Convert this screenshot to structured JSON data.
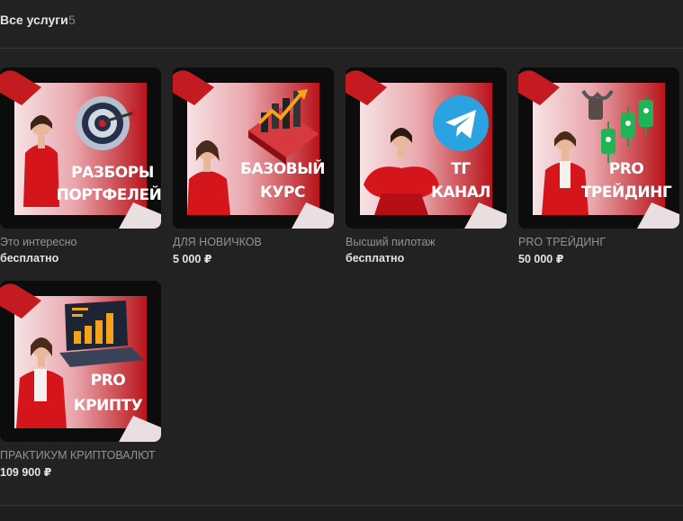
{
  "section": {
    "title": "Все услуги",
    "count": "5"
  },
  "cards": [
    {
      "name": "Это интересно",
      "price": "бесплатно",
      "caption": [
        "РАЗБОРЫ",
        "ПОРТФЕЛЕЙ"
      ],
      "icon": "target-icon"
    },
    {
      "name": "ДЛЯ НОВИЧКОВ",
      "price": "5 000 ₽",
      "caption": [
        "БАЗОВЫЙ",
        "КУРС"
      ],
      "icon": "growth-chart-icon"
    },
    {
      "name": "Высший пилотаж",
      "price": "бесплатно",
      "caption": [
        "ТГ",
        "КАНАЛ"
      ],
      "icon": "telegram-icon"
    },
    {
      "name": "PRO ТРЕЙДИНГ",
      "price": "50 000 ₽",
      "caption": [
        "PRO",
        "ТРЕЙДИНГ"
      ],
      "icon": "candles-icon"
    },
    {
      "name": "ПРАКТИКУМ КРИПТОВАЛЮТ",
      "price": "109 900 ₽",
      "caption": [
        "PRO",
        "КРИПТУ"
      ],
      "icon": "laptop-chart-icon"
    }
  ],
  "colors": {
    "background": "#222222",
    "card_red": "#c01a1a",
    "card_pink": "#f2cfd2",
    "telegram_blue": "#2aa3e0"
  }
}
